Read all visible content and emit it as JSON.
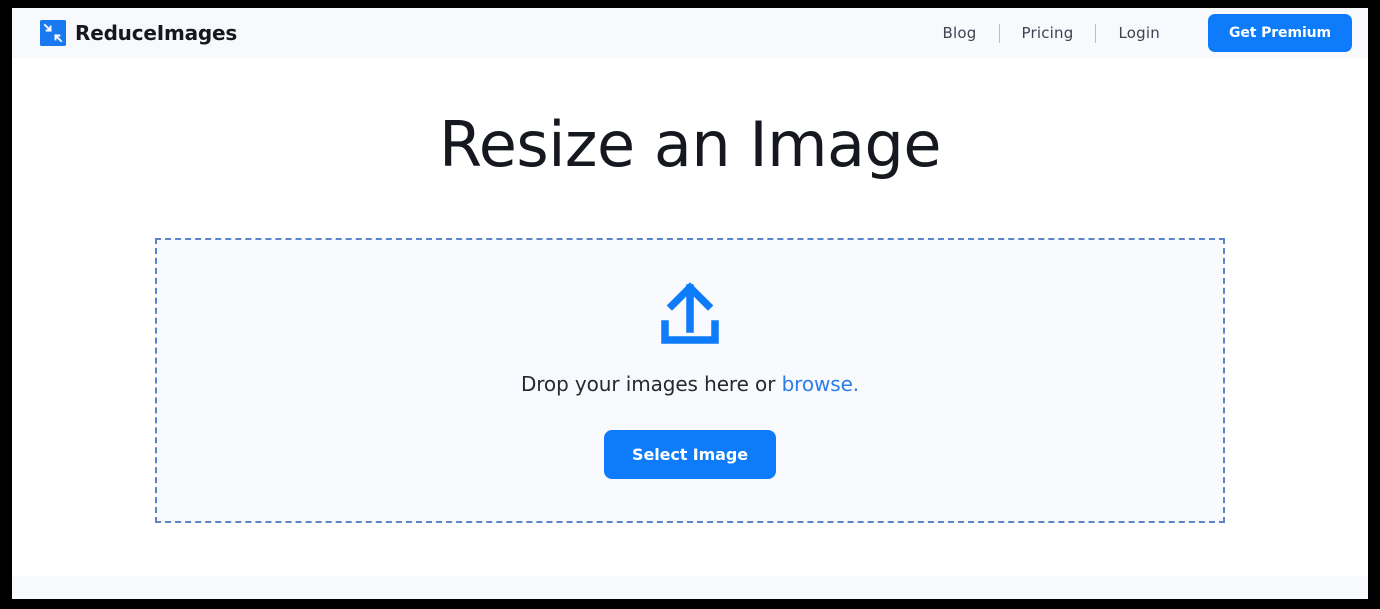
{
  "header": {
    "brand": {
      "icon": "resize-arrows-icon",
      "name": "ReduceImages"
    },
    "nav": [
      {
        "label": "Blog"
      },
      {
        "label": "Pricing"
      },
      {
        "label": "Login"
      }
    ],
    "premium_button": "Get Premium"
  },
  "main": {
    "title": "Resize an Image",
    "dropzone": {
      "icon": "upload-icon",
      "text_before": "Drop your images here or ",
      "browse_link": "browse.",
      "select_button": "Select Image"
    }
  },
  "colors": {
    "accent_blue": "#0d7bfa",
    "link_blue": "#2b7de9",
    "dashed_border": "#5b85c8",
    "header_bg": "#f8f9fd",
    "dropzone_bg": "#f9fafd",
    "text_dark": "#15181f"
  }
}
